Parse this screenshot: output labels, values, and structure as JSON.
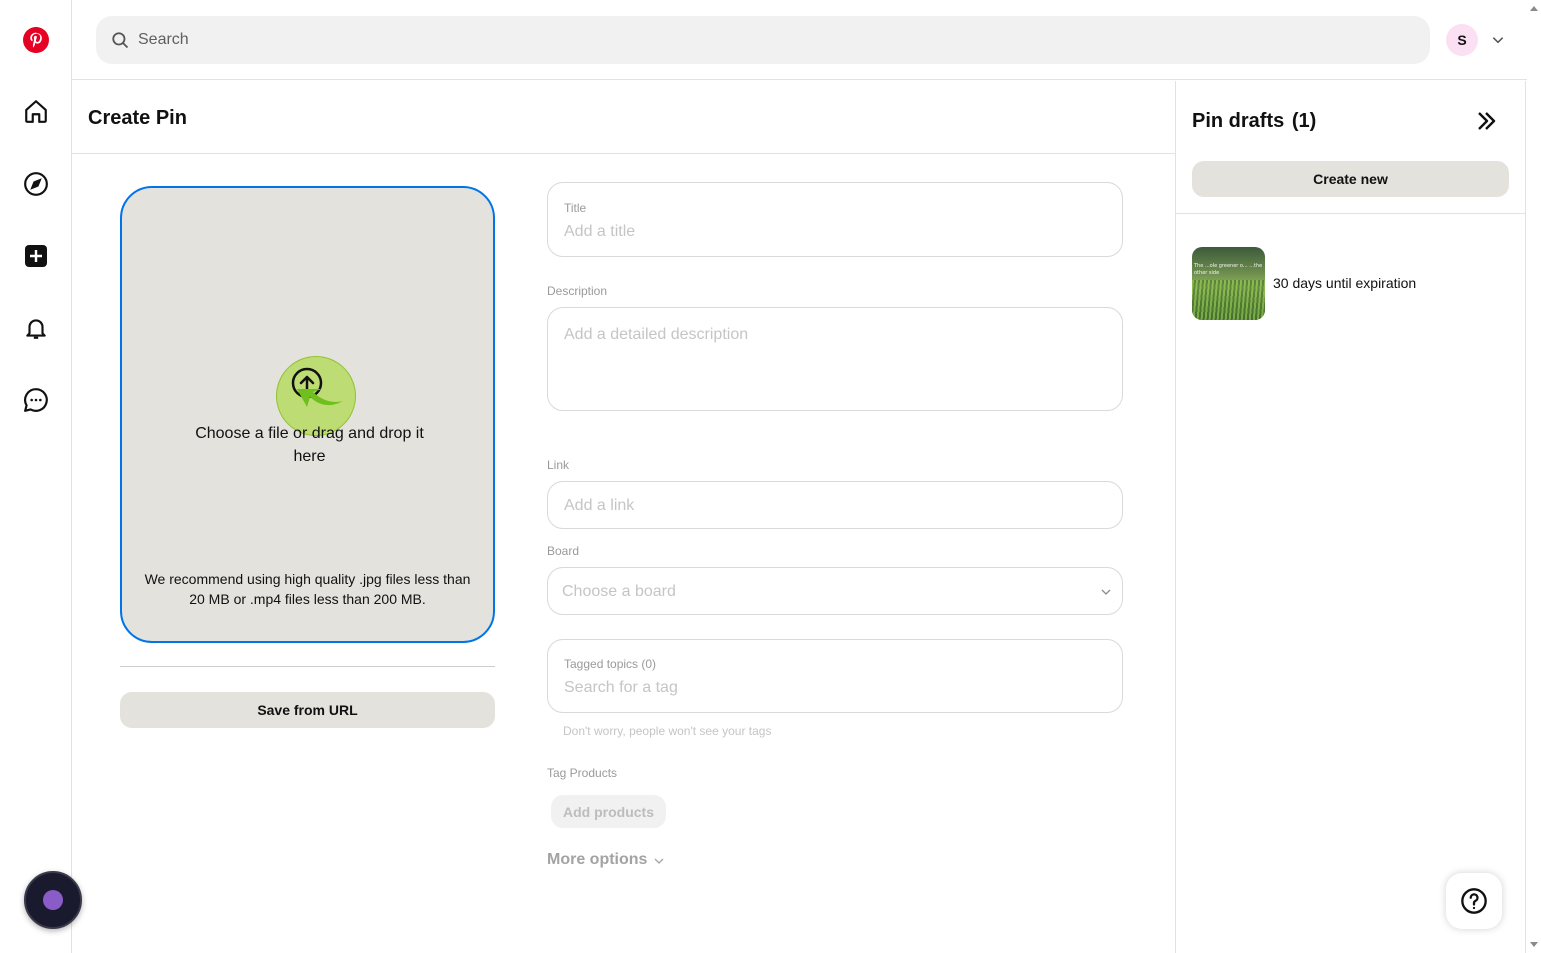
{
  "brand": {
    "logo_icon": "pinterest-logo-icon",
    "color": "#e60023"
  },
  "rail": {
    "items": [
      {
        "name": "home",
        "icon": "home-icon"
      },
      {
        "name": "explore",
        "icon": "compass-icon"
      },
      {
        "name": "create",
        "icon": "plus-square-icon"
      },
      {
        "name": "updates",
        "icon": "bell-icon"
      },
      {
        "name": "messages",
        "icon": "chat-bubble-icon"
      }
    ]
  },
  "topbar": {
    "search_placeholder": "Search",
    "avatar_initial": "S"
  },
  "page": {
    "title": "Create Pin"
  },
  "upload": {
    "prompt": "Choose a file or drag and drop it here",
    "hint": "We recommend using high quality .jpg files less than 20 MB or .mp4 files less than 200 MB.",
    "save_from_url": "Save from URL"
  },
  "form": {
    "title_label": "Title",
    "title_placeholder": "Add a title",
    "description_label": "Description",
    "description_placeholder": "Add a detailed description",
    "link_label": "Link",
    "link_placeholder": "Add a link",
    "board_label": "Board",
    "board_placeholder": "Choose a board",
    "topics_label": "Tagged topics (0)",
    "topics_placeholder": "Search for a tag",
    "topics_hint": "Don't worry, people won't see your tags",
    "products_label": "Tag Products",
    "add_products": "Add products",
    "more_options": "More options"
  },
  "drafts": {
    "title": "Pin drafts",
    "count": "(1)",
    "create_new": "Create new",
    "items": [
      {
        "thumb_text": "The ...ole greener o... ...the other side",
        "expiration": "30 days until expiration"
      }
    ]
  },
  "colors": {
    "accent_border": "#0074e8",
    "upload_bg": "#e3e2dd",
    "assistant_dot": "#8a5cc8"
  }
}
